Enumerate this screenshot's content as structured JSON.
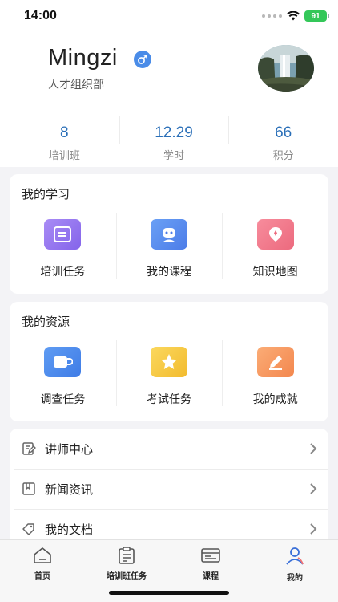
{
  "status_bar": {
    "time": "14:00",
    "battery": "91"
  },
  "profile": {
    "name": "Mingzi",
    "gender_icon": "male-icon",
    "department": "人才组织部",
    "stats": [
      {
        "value": "8",
        "label": "培训班"
      },
      {
        "value": "12.29",
        "label": "学时"
      },
      {
        "value": "66",
        "label": "积分"
      }
    ]
  },
  "my_learning": {
    "title": "我的学习",
    "items": [
      {
        "label": "培训任务",
        "icon": "document-icon",
        "color": "#9b7cf0"
      },
      {
        "label": "我的课程",
        "icon": "robot-icon",
        "color": "#5a8ef0"
      },
      {
        "label": "知识地图",
        "icon": "map-pin-icon",
        "color": "#f27b8e"
      }
    ]
  },
  "my_resources": {
    "title": "我的资源",
    "items": [
      {
        "label": "调查任务",
        "icon": "cup-icon",
        "color": "#4d8ef0"
      },
      {
        "label": "考试任务",
        "icon": "star-icon",
        "color": "#f6c642"
      },
      {
        "label": "我的成就",
        "icon": "pencil-icon",
        "color": "#f59a62"
      }
    ]
  },
  "menu": [
    {
      "label": "讲师中心",
      "icon": "edit-note-icon"
    },
    {
      "label": "新闻资讯",
      "icon": "bookmark-icon"
    },
    {
      "label": "我的文档",
      "icon": "tag-icon"
    }
  ],
  "tabbar": [
    {
      "label": "首页",
      "icon": "home-icon"
    },
    {
      "label": "培训班任务",
      "icon": "clipboard-icon"
    },
    {
      "label": "课程",
      "icon": "course-icon"
    },
    {
      "label": "我的",
      "icon": "user-icon"
    }
  ]
}
